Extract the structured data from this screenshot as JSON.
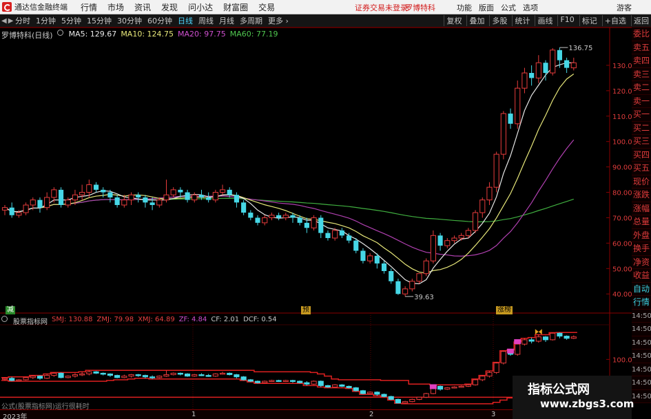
{
  "titlebar": {
    "app_title": "通达信金融终端",
    "menu": [
      "行情",
      "市场",
      "资讯",
      "发现",
      "问小达",
      "财富圈",
      "交易"
    ],
    "security_warning": "证券交易未登录",
    "stock_name": "罗博特科",
    "right_menu": [
      "功能",
      "版面",
      "公式",
      "选项"
    ],
    "guest": "游客"
  },
  "toolbar": {
    "periods": [
      "分时",
      "1分钟",
      "5分钟",
      "15分钟",
      "30分钟",
      "60分钟",
      "日线",
      "周线",
      "月线",
      "多周期",
      "更多"
    ],
    "active_period": "日线",
    "right_tools": [
      "复权",
      "叠加",
      "多股",
      "统计",
      "画线",
      "F10",
      "标记",
      "+自选",
      "返回"
    ]
  },
  "chart_info": {
    "stock_label": "罗博特科(日线)",
    "ma5": "MA5: 129.67",
    "ma10": "MA10: 124.75",
    "ma20": "MA20: 97.75",
    "ma60": "MA60: 77.19"
  },
  "price_axis": [
    "130.00",
    "120.00",
    "110.00",
    "100.00",
    "90.00",
    "80.00",
    "70.00",
    "60.00",
    "50.00",
    "40.00"
  ],
  "annotations": {
    "high": "136.75",
    "low": "39.63"
  },
  "tags": {
    "left": "减",
    "mid": "预",
    "right": "涨榜"
  },
  "side_tabs": [
    "委比",
    "卖五",
    "卖四",
    "卖三",
    "卖二",
    "卖一",
    "买一",
    "买二",
    "买三",
    "买四",
    "买五",
    "现价",
    "涨跌",
    "涨幅",
    "总量",
    "外盘",
    "换手",
    "净资",
    "收益",
    "自动",
    "行情",
    "14:50",
    "14:50",
    "14:50",
    "14:50",
    "14:50",
    "14:50",
    "14:50"
  ],
  "indicator": {
    "name": "股票指标网",
    "smj": "SMJ: 130.88",
    "zmj": "ZMJ: 79.98",
    "xmj": "XMJ: 64.89",
    "zf": "ZF: 4.84",
    "cf": "CF: 2.01",
    "dcf": "DCF: 0.54",
    "axis_label": "100.0"
  },
  "formula_label": "公式(股票指标网)运行很耗时",
  "date_axis": {
    "start": "2023年",
    "m1": "1",
    "m2": "2",
    "m3": "3"
  },
  "watermark": {
    "cn": "指标公式网",
    "url": "www.zbgs3.com"
  },
  "colors": {
    "up": "#e83c3c",
    "down": "#46d7e6",
    "ma5": "#e8e8e8",
    "ma10": "#e8e87a",
    "ma20": "#b040b0",
    "ma60": "#40b040"
  },
  "chart_data": {
    "type": "candlestick",
    "ylim": [
      36,
      140
    ],
    "candles": [
      [
        73,
        74,
        71,
        75
      ],
      [
        74,
        71,
        70,
        76
      ],
      [
        71,
        72,
        70,
        73
      ],
      [
        72,
        75,
        71,
        76
      ],
      [
        75,
        77,
        73,
        78
      ],
      [
        77,
        74,
        72,
        78
      ],
      [
        74,
        78,
        73,
        80
      ],
      [
        78,
        81,
        76,
        82
      ],
      [
        81,
        75,
        74,
        82
      ],
      [
        75,
        77,
        74,
        78
      ],
      [
        77,
        79,
        75,
        81
      ],
      [
        79,
        80,
        77,
        83
      ],
      [
        80,
        83,
        78,
        85
      ],
      [
        83,
        81,
        80,
        84
      ],
      [
        81,
        80,
        78,
        82
      ],
      [
        80,
        78,
        76,
        81
      ],
      [
        78,
        75,
        74,
        79
      ],
      [
        75,
        77,
        74,
        79
      ],
      [
        77,
        79,
        75,
        80
      ],
      [
        79,
        78,
        76,
        80
      ],
      [
        78,
        76,
        74,
        79
      ],
      [
        76,
        75,
        73,
        78
      ],
      [
        75,
        77,
        74,
        78
      ],
      [
        77,
        79,
        76,
        85
      ],
      [
        79,
        81,
        78,
        82
      ],
      [
        81,
        80,
        78,
        82
      ],
      [
        80,
        77,
        76,
        81
      ],
      [
        77,
        79,
        76,
        80
      ],
      [
        79,
        78,
        77,
        81
      ],
      [
        78,
        77,
        76,
        80
      ],
      [
        77,
        80,
        76,
        81
      ],
      [
        80,
        81,
        79,
        83
      ],
      [
        81,
        79,
        78,
        82
      ],
      [
        79,
        76,
        74,
        80
      ],
      [
        76,
        72,
        71,
        77
      ],
      [
        72,
        70,
        69,
        73
      ],
      [
        70,
        68,
        67,
        71
      ],
      [
        68,
        70,
        67,
        71
      ],
      [
        70,
        71,
        69,
        72
      ],
      [
        71,
        70,
        69,
        72
      ],
      [
        70,
        71,
        69,
        72
      ],
      [
        71,
        70,
        68,
        72
      ],
      [
        70,
        68,
        67,
        71
      ],
      [
        68,
        66,
        64,
        70
      ],
      [
        66,
        70,
        65,
        71
      ],
      [
        70,
        64,
        62,
        71
      ],
      [
        64,
        62,
        61,
        65
      ],
      [
        62,
        65,
        61,
        66
      ],
      [
        65,
        63,
        62,
        66
      ],
      [
        63,
        61,
        60,
        64
      ],
      [
        61,
        57,
        56,
        62
      ],
      [
        57,
        53,
        52,
        58
      ],
      [
        53,
        55,
        52,
        56
      ],
      [
        55,
        52,
        50,
        56
      ],
      [
        52,
        49,
        48,
        53
      ],
      [
        49,
        45,
        44,
        50
      ],
      [
        45,
        40,
        39.63,
        46
      ],
      [
        40,
        42,
        39,
        43
      ],
      [
        42,
        45,
        41,
        46
      ],
      [
        45,
        48,
        44,
        48
      ],
      [
        48,
        53,
        47,
        54
      ],
      [
        53,
        63,
        52,
        65
      ],
      [
        63,
        59,
        57,
        64
      ],
      [
        59,
        61,
        58,
        62
      ],
      [
        61,
        62,
        60,
        63
      ],
      [
        62,
        63,
        61,
        64
      ],
      [
        63,
        65,
        62,
        66
      ],
      [
        65,
        72,
        64,
        73
      ],
      [
        72,
        77,
        70,
        78
      ],
      [
        77,
        82,
        75,
        84
      ],
      [
        82,
        95,
        80,
        96
      ],
      [
        95,
        111,
        93,
        112
      ],
      [
        111,
        107,
        105,
        113
      ],
      [
        107,
        121,
        105,
        124
      ],
      [
        121,
        127,
        119,
        129
      ],
      [
        127,
        125,
        122,
        130
      ],
      [
        125,
        131,
        123,
        134
      ],
      [
        131,
        127,
        124,
        132
      ],
      [
        127,
        136,
        126,
        136.75
      ],
      [
        136,
        132,
        129,
        137
      ],
      [
        132,
        129,
        127,
        133
      ],
      [
        129,
        131,
        128,
        133
      ]
    ]
  }
}
